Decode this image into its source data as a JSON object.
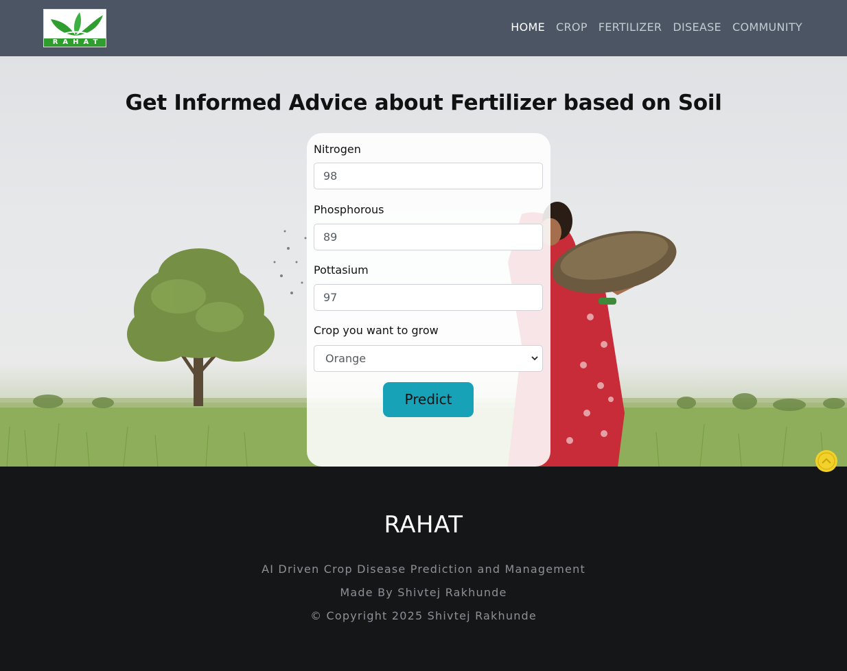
{
  "header": {
    "logo_text": "RAHAT",
    "nav": [
      {
        "label": "HOME",
        "active": true
      },
      {
        "label": "CROP",
        "active": false
      },
      {
        "label": "FERTILIZER",
        "active": false
      },
      {
        "label": "DISEASE",
        "active": false
      },
      {
        "label": "COMMUNITY",
        "active": false
      }
    ]
  },
  "main": {
    "title": "Get Informed Advice about Fertilizer based on Soil",
    "form": {
      "nitrogen": {
        "label": "Nitrogen",
        "value": "98"
      },
      "phosphorous": {
        "label": "Phosphorous",
        "value": "89"
      },
      "pottasium": {
        "label": "Pottasium",
        "value": "97"
      },
      "crop": {
        "label": "Crop you want to grow",
        "selected": "Orange"
      },
      "submit_label": "Predict"
    }
  },
  "footer": {
    "brand": "RAHAT",
    "tagline": "AI Driven Crop Disease Prediction and Management",
    "made_by": "Made By Shivtej Rakhunde",
    "copyright": "© Copyright 2025 Shivtej Rakhunde"
  },
  "colors": {
    "header_bg": "#4b5563",
    "button_bg": "#17a2b8",
    "footer_bg": "#151617",
    "scroll_top_bg": "#f2d12b"
  },
  "icons": {
    "logo": "leaf-logo-icon",
    "select": "chevron-down-icon",
    "scroll_top": "chevron-up-icon"
  }
}
